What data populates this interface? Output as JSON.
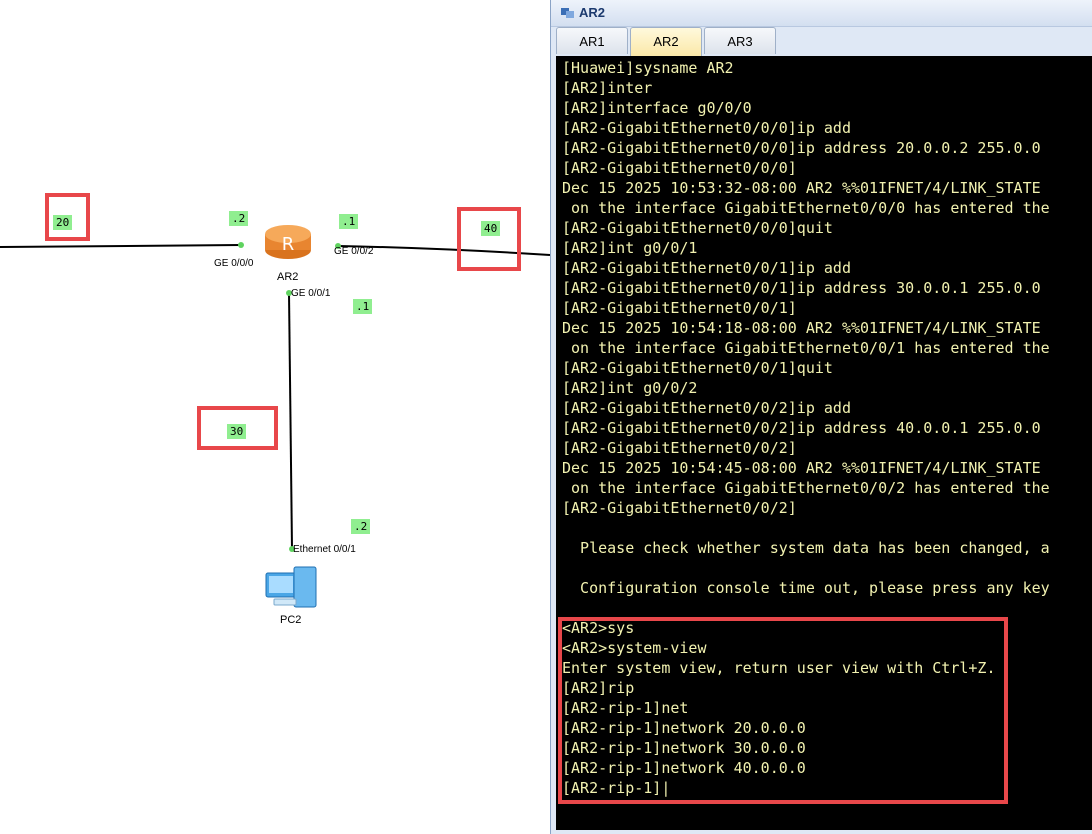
{
  "topology": {
    "devices": [
      {
        "name": "AR2",
        "icon": "router-icon"
      },
      {
        "name": "PC2",
        "icon": "pc-icon"
      }
    ],
    "ports": {
      "ge000": "GE 0/0/0",
      "ge002": "GE 0/0/2",
      "ge001": "GE 0/0/1",
      "eth001": "Ethernet 0/0/1"
    },
    "host_labels": {
      "ge000": ".2",
      "ge002": ".1",
      "ge001": ".1",
      "pc": ".2"
    },
    "network_labels": {
      "left": "20",
      "right": "40",
      "down": "30"
    },
    "colors": {
      "label_bg": "#90ee90",
      "highlight": "#e8474a",
      "link": "#000000",
      "port_dot": "#5fd35f"
    }
  },
  "window": {
    "title": "AR2",
    "tabs": [
      {
        "label": "AR1",
        "active": false
      },
      {
        "label": "AR2",
        "active": true
      },
      {
        "label": "AR3",
        "active": false
      }
    ],
    "terminal": {
      "fg_color": "#f2f2b0",
      "bg_color": "#000000",
      "lines": [
        "[Huawei]sysname AR2",
        "[AR2]inter",
        "[AR2]interface g0/0/0",
        "[AR2-GigabitEthernet0/0/0]ip add",
        "[AR2-GigabitEthernet0/0/0]ip address 20.0.0.2 255.0.0",
        "[AR2-GigabitEthernet0/0/0]",
        "Dec 15 2025 10:53:32-08:00 AR2 %%01IFNET/4/LINK_STATE",
        " on the interface GigabitEthernet0/0/0 has entered the",
        "[AR2-GigabitEthernet0/0/0]quit",
        "[AR2]int g0/0/1",
        "[AR2-GigabitEthernet0/0/1]ip add",
        "[AR2-GigabitEthernet0/0/1]ip address 30.0.0.1 255.0.0",
        "[AR2-GigabitEthernet0/0/1]",
        "Dec 15 2025 10:54:18-08:00 AR2 %%01IFNET/4/LINK_STATE",
        " on the interface GigabitEthernet0/0/1 has entered the",
        "[AR2-GigabitEthernet0/0/1]quit",
        "[AR2]int g0/0/2",
        "[AR2-GigabitEthernet0/0/2]ip add",
        "[AR2-GigabitEthernet0/0/2]ip address 40.0.0.1 255.0.0",
        "[AR2-GigabitEthernet0/0/2]",
        "Dec 15 2025 10:54:45-08:00 AR2 %%01IFNET/4/LINK_STATE",
        " on the interface GigabitEthernet0/0/2 has entered the",
        "[AR2-GigabitEthernet0/0/2]",
        "",
        "  Please check whether system data has been changed, a",
        "",
        "  Configuration console time out, please press any key",
        "",
        "<AR2>sys",
        "<AR2>system-view",
        "Enter system view, return user view with Ctrl+Z.",
        "[AR2]rip",
        "[AR2-rip-1]net",
        "[AR2-rip-1]network 20.0.0.0",
        "[AR2-rip-1]network 30.0.0.0",
        "[AR2-rip-1]network 40.0.0.0",
        "[AR2-rip-1]|"
      ]
    }
  }
}
